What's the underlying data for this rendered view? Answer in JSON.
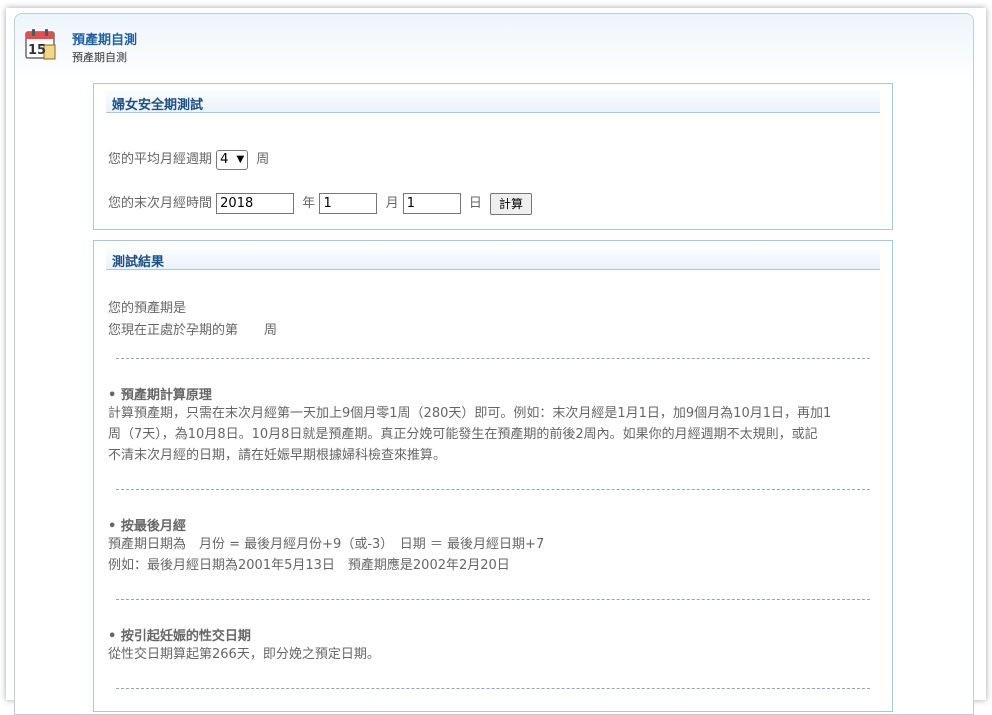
{
  "header": {
    "title": "預產期自測",
    "subtitle": "預產期自測",
    "icon": "calendar-icon",
    "icon_number": "15"
  },
  "form_panel": {
    "title": "婦女安全期測試",
    "cycle_label": "您的平均月經週期",
    "cycle_value": "4",
    "cycle_unit": "周",
    "last_period_label": "您的末次月經時間",
    "year_value": "2018",
    "year_unit": "年",
    "month_value": "1",
    "month_unit": "月",
    "day_value": "1",
    "day_unit": "日",
    "calc_button": "計算"
  },
  "result_panel": {
    "title": "測試結果",
    "due_date_line": "您的預產期是",
    "week_line_prefix": "您現在正處於孕期的第",
    "week_line_suffix": "周",
    "sections": [
      {
        "heading": "• 預產期計算原理",
        "lines": [
          "計算預產期，只需在末次月經第一天加上9個月零1周（280天）即可。例如：末次月經是1月1日，加9個月為10月1日，再加1",
          "周（7天），為10月8日。10月8日就是預產期。真正分娩可能發生在預產期的前後2周內。如果你的月經週期不太規則，或記",
          "不清末次月經的日期，請在妊娠早期根據婦科檢查來推算。"
        ]
      },
      {
        "heading": "• 按最後月經",
        "lines": [
          "預產期日期為　月份 = 最後月經月份+9（或-3）　日期 ＝ 最後月經日期+7",
          "例如：最後月經日期為2001年5月13日　預產期應是2002年2月20日"
        ]
      },
      {
        "heading": "• 按引起妊娠的性交日期",
        "lines": [
          "從性交日期算起第266天，即分娩之預定日期。"
        ]
      }
    ]
  }
}
